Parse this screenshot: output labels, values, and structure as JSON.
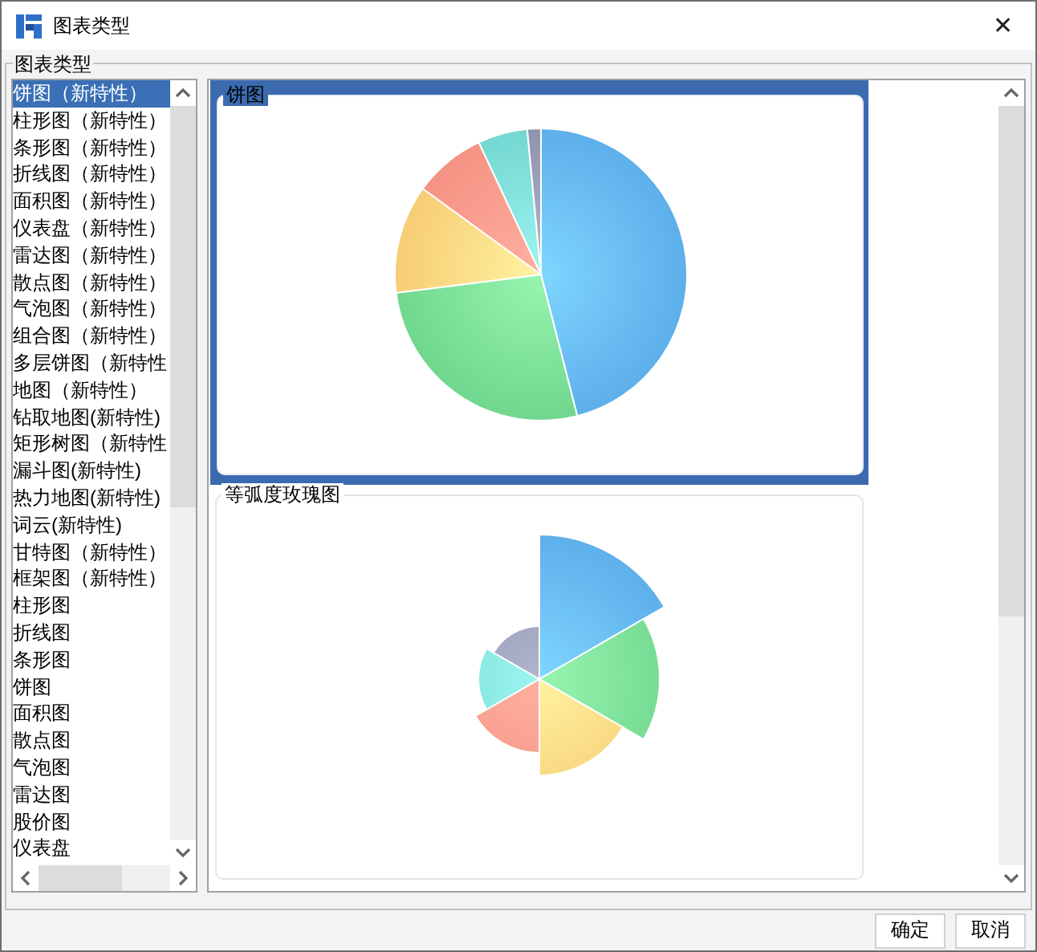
{
  "window": {
    "title": "图表类型",
    "close": "✕"
  },
  "group": {
    "title": "图表类型"
  },
  "chart_types": [
    {
      "label": "饼图（新特性）",
      "selected": true
    },
    {
      "label": "柱形图（新特性）",
      "selected": false
    },
    {
      "label": "条形图（新特性）",
      "selected": false
    },
    {
      "label": "折线图（新特性）",
      "selected": false
    },
    {
      "label": "面积图（新特性）",
      "selected": false
    },
    {
      "label": "仪表盘（新特性）",
      "selected": false
    },
    {
      "label": "雷达图（新特性）",
      "selected": false
    },
    {
      "label": "散点图（新特性）",
      "selected": false
    },
    {
      "label": "气泡图（新特性）",
      "selected": false
    },
    {
      "label": "组合图（新特性）",
      "selected": false
    },
    {
      "label": "多层饼图（新特性",
      "selected": false
    },
    {
      "label": "地图（新特性）",
      "selected": false
    },
    {
      "label": "钻取地图(新特性)",
      "selected": false
    },
    {
      "label": "矩形树图（新特性",
      "selected": false
    },
    {
      "label": "漏斗图(新特性)",
      "selected": false
    },
    {
      "label": "热力地图(新特性)",
      "selected": false
    },
    {
      "label": "词云(新特性)",
      "selected": false
    },
    {
      "label": "甘特图（新特性）",
      "selected": false
    },
    {
      "label": "框架图（新特性）",
      "selected": false
    },
    {
      "label": "柱形图",
      "selected": false
    },
    {
      "label": "折线图",
      "selected": false
    },
    {
      "label": "条形图",
      "selected": false
    },
    {
      "label": "饼图",
      "selected": false
    },
    {
      "label": "面积图",
      "selected": false
    },
    {
      "label": "散点图",
      "selected": false
    },
    {
      "label": "气泡图",
      "selected": false
    },
    {
      "label": "雷达图",
      "selected": false
    },
    {
      "label": "股价图",
      "selected": false
    },
    {
      "label": "仪表盘",
      "selected": false
    }
  ],
  "previews": [
    {
      "title": "饼图",
      "kind": "pie",
      "selected": true
    },
    {
      "title": "等弧度玫瑰图",
      "kind": "rose",
      "selected": false
    }
  ],
  "buttons": [
    "确定",
    "取消"
  ]
}
